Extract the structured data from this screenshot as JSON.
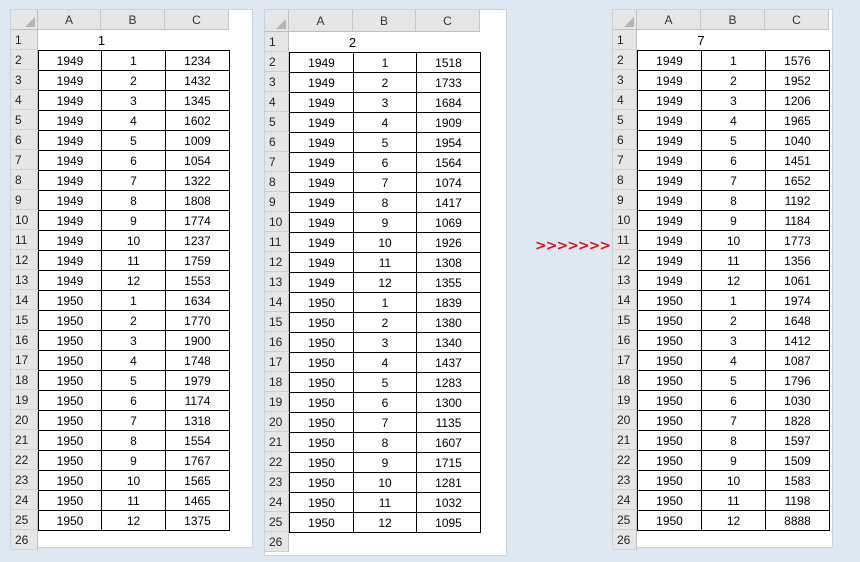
{
  "columns": [
    "A",
    "B",
    "C"
  ],
  "rows": [
    "1",
    "2",
    "3",
    "4",
    "5",
    "6",
    "7",
    "8",
    "9",
    "10",
    "11",
    "12",
    "13",
    "14",
    "15",
    "16",
    "17",
    "18",
    "19",
    "20",
    "21",
    "22",
    "23",
    "24",
    "25",
    "26"
  ],
  "arrow": ">>>>>>>",
  "sheets": [
    {
      "title": "1",
      "data": [
        [
          "1949",
          "1",
          "1234"
        ],
        [
          "1949",
          "2",
          "1432"
        ],
        [
          "1949",
          "3",
          "1345"
        ],
        [
          "1949",
          "4",
          "1602"
        ],
        [
          "1949",
          "5",
          "1009"
        ],
        [
          "1949",
          "6",
          "1054"
        ],
        [
          "1949",
          "7",
          "1322"
        ],
        [
          "1949",
          "8",
          "1808"
        ],
        [
          "1949",
          "9",
          "1774"
        ],
        [
          "1949",
          "10",
          "1237"
        ],
        [
          "1949",
          "11",
          "1759"
        ],
        [
          "1949",
          "12",
          "1553"
        ],
        [
          "1950",
          "1",
          "1634"
        ],
        [
          "1950",
          "2",
          "1770"
        ],
        [
          "1950",
          "3",
          "1900"
        ],
        [
          "1950",
          "4",
          "1748"
        ],
        [
          "1950",
          "5",
          "1979"
        ],
        [
          "1950",
          "6",
          "1174"
        ],
        [
          "1950",
          "7",
          "1318"
        ],
        [
          "1950",
          "8",
          "1554"
        ],
        [
          "1950",
          "9",
          "1767"
        ],
        [
          "1950",
          "10",
          "1565"
        ],
        [
          "1950",
          "11",
          "1465"
        ],
        [
          "1950",
          "12",
          "1375"
        ]
      ]
    },
    {
      "title": "2",
      "data": [
        [
          "1949",
          "1",
          "1518"
        ],
        [
          "1949",
          "2",
          "1733"
        ],
        [
          "1949",
          "3",
          "1684"
        ],
        [
          "1949",
          "4",
          "1909"
        ],
        [
          "1949",
          "5",
          "1954"
        ],
        [
          "1949",
          "6",
          "1564"
        ],
        [
          "1949",
          "7",
          "1074"
        ],
        [
          "1949",
          "8",
          "1417"
        ],
        [
          "1949",
          "9",
          "1069"
        ],
        [
          "1949",
          "10",
          "1926"
        ],
        [
          "1949",
          "11",
          "1308"
        ],
        [
          "1949",
          "12",
          "1355"
        ],
        [
          "1950",
          "1",
          "1839"
        ],
        [
          "1950",
          "2",
          "1380"
        ],
        [
          "1950",
          "3",
          "1340"
        ],
        [
          "1950",
          "4",
          "1437"
        ],
        [
          "1950",
          "5",
          "1283"
        ],
        [
          "1950",
          "6",
          "1300"
        ],
        [
          "1950",
          "7",
          "1135"
        ],
        [
          "1950",
          "8",
          "1607"
        ],
        [
          "1950",
          "9",
          "1715"
        ],
        [
          "1950",
          "10",
          "1281"
        ],
        [
          "1950",
          "11",
          "1032"
        ],
        [
          "1950",
          "12",
          "1095"
        ]
      ]
    },
    {
      "title": "7",
      "data": [
        [
          "1949",
          "1",
          "1576"
        ],
        [
          "1949",
          "2",
          "1952"
        ],
        [
          "1949",
          "3",
          "1206"
        ],
        [
          "1949",
          "4",
          "1965"
        ],
        [
          "1949",
          "5",
          "1040"
        ],
        [
          "1949",
          "6",
          "1451"
        ],
        [
          "1949",
          "7",
          "1652"
        ],
        [
          "1949",
          "8",
          "1192"
        ],
        [
          "1949",
          "9",
          "1184"
        ],
        [
          "1949",
          "10",
          "1773"
        ],
        [
          "1949",
          "11",
          "1356"
        ],
        [
          "1949",
          "12",
          "1061"
        ],
        [
          "1950",
          "1",
          "1974"
        ],
        [
          "1950",
          "2",
          "1648"
        ],
        [
          "1950",
          "3",
          "1412"
        ],
        [
          "1950",
          "4",
          "1087"
        ],
        [
          "1950",
          "5",
          "1796"
        ],
        [
          "1950",
          "6",
          "1030"
        ],
        [
          "1950",
          "7",
          "1828"
        ],
        [
          "1950",
          "8",
          "1597"
        ],
        [
          "1950",
          "9",
          "1509"
        ],
        [
          "1950",
          "10",
          "1583"
        ],
        [
          "1950",
          "11",
          "1198"
        ],
        [
          "1950",
          "12",
          "8888"
        ]
      ]
    }
  ]
}
